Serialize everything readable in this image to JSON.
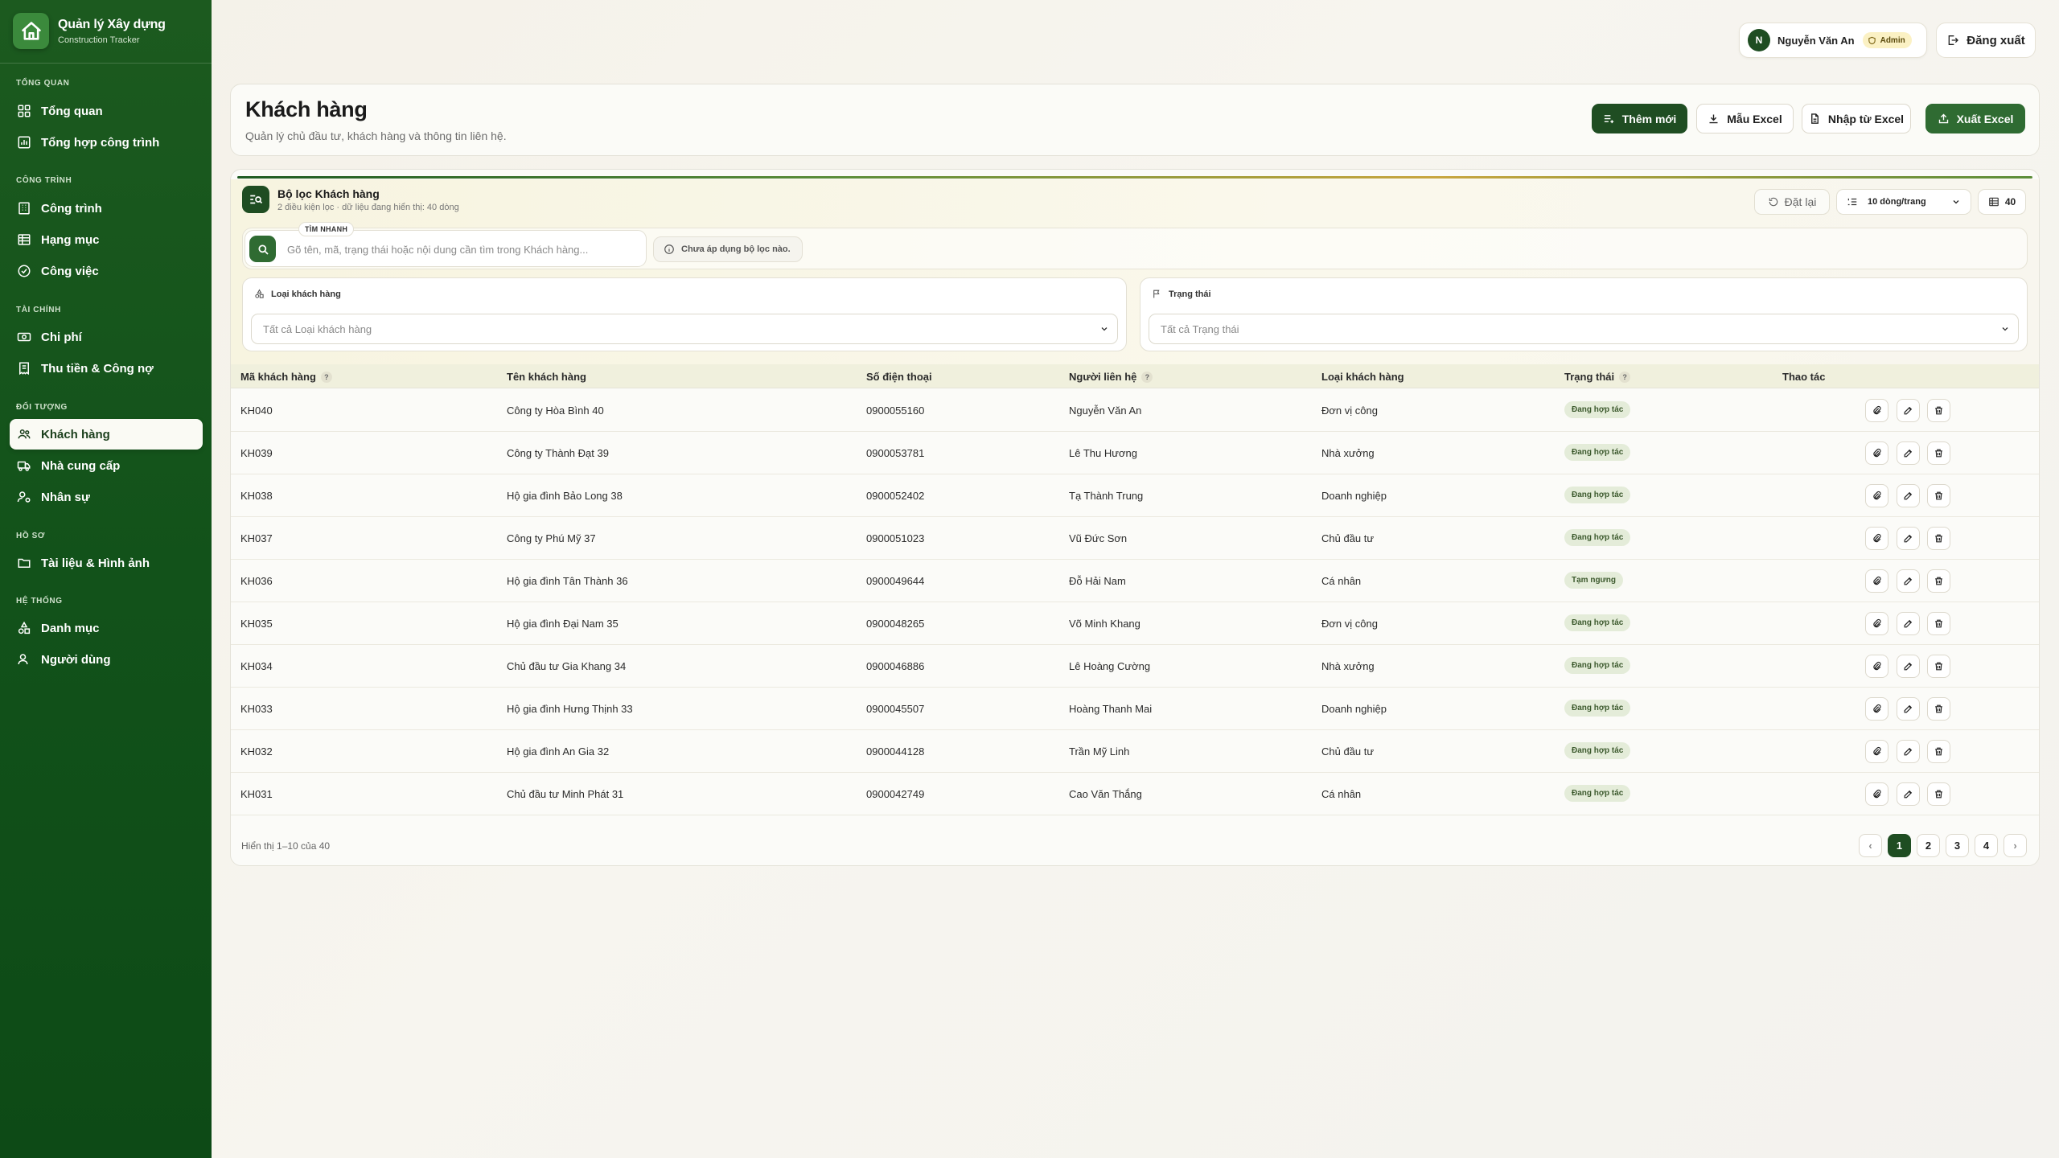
{
  "brand": {
    "title": "Quản lý Xây dựng",
    "subtitle": "Construction Tracker"
  },
  "sidebar": {
    "sections": [
      {
        "label": "TỔNG QUAN",
        "items": [
          {
            "label": "Tổng quan",
            "icon": "dashboard-icon"
          },
          {
            "label": "Tổng hợp công trình",
            "icon": "report-icon"
          }
        ]
      },
      {
        "label": "CÔNG TRÌNH",
        "items": [
          {
            "label": "Công trình",
            "icon": "building-icon"
          },
          {
            "label": "Hạng mục",
            "icon": "table-icon"
          },
          {
            "label": "Công việc",
            "icon": "check-circle-icon"
          }
        ]
      },
      {
        "label": "TÀI CHÍNH",
        "items": [
          {
            "label": "Chi phí",
            "icon": "money-icon"
          },
          {
            "label": "Thu tiền & Công nợ",
            "icon": "receipt-icon"
          }
        ]
      },
      {
        "label": "ĐỐI TƯỢNG",
        "items": [
          {
            "label": "Khách hàng",
            "icon": "users-icon",
            "active": true
          },
          {
            "label": "Nhà cung cấp",
            "icon": "truck-icon"
          },
          {
            "label": "Nhân sự",
            "icon": "user-cog-icon"
          }
        ]
      },
      {
        "label": "HỒ SƠ",
        "items": [
          {
            "label": "Tài liệu & Hình ảnh",
            "icon": "folder-icon"
          }
        ]
      },
      {
        "label": "HỆ THỐNG",
        "items": [
          {
            "label": "Danh mục",
            "icon": "shapes-icon"
          },
          {
            "label": "Người dùng",
            "icon": "user-icon"
          }
        ]
      }
    ]
  },
  "user": {
    "initial": "N",
    "name": "Nguyễn Văn An",
    "role": "Admin",
    "logout": "Đăng xuất"
  },
  "header": {
    "title": "Khách hàng",
    "subtitle": "Quản lý chủ đầu tư, khách hàng và thông tin liên hệ.",
    "buttons": {
      "add": "Thêm mới",
      "template": "Mẫu Excel",
      "import": "Nhập từ Excel",
      "export": "Xuất Excel"
    }
  },
  "filter": {
    "title": "Bộ lọc Khách hàng",
    "subtitle": "2 điều kiện lọc · dữ liệu đang hiển thị: 40 dòng",
    "reset": "Đặt lại",
    "page_size": "10 dòng/trang",
    "total": "40",
    "search_tag": "TÌM NHANH",
    "search_placeholder": "Gõ tên, mã, trạng thái hoặc nội dung cần tìm trong Khách hàng...",
    "no_filter": "Chưa áp dụng bộ lọc nào.",
    "type_label": "Loại khách hàng",
    "type_value": "Tất cả Loại khách hàng",
    "status_label": "Trạng thái",
    "status_value": "Tất cả Trạng thái"
  },
  "table": {
    "columns": [
      "Mã khách hàng",
      "Tên khách hàng",
      "Số điện thoại",
      "Người liên hệ",
      "Loại khách hàng",
      "Trạng thái",
      "Thao tác"
    ],
    "help_mark": "?",
    "rows": [
      {
        "code": "KH040",
        "name": "Công ty Hòa Bình 40",
        "phone": "0900055160",
        "contact": "Nguyễn Văn An",
        "type": "Đơn vị công",
        "status": "Đang hợp tác"
      },
      {
        "code": "KH039",
        "name": "Công ty Thành Đạt 39",
        "phone": "0900053781",
        "contact": "Lê Thu Hương",
        "type": "Nhà xưởng",
        "status": "Đang hợp tác"
      },
      {
        "code": "KH038",
        "name": "Hộ gia đình Bảo Long 38",
        "phone": "0900052402",
        "contact": "Tạ Thành Trung",
        "type": "Doanh nghiệp",
        "status": "Đang hợp tác"
      },
      {
        "code": "KH037",
        "name": "Công ty Phú Mỹ 37",
        "phone": "0900051023",
        "contact": "Vũ Đức Sơn",
        "type": "Chủ đầu tư",
        "status": "Đang hợp tác"
      },
      {
        "code": "KH036",
        "name": "Hộ gia đình Tân Thành 36",
        "phone": "0900049644",
        "contact": "Đỗ Hải Nam",
        "type": "Cá nhân",
        "status": "Tạm ngưng"
      },
      {
        "code": "KH035",
        "name": "Hộ gia đình Đại Nam 35",
        "phone": "0900048265",
        "contact": "Võ Minh Khang",
        "type": "Đơn vị công",
        "status": "Đang hợp tác"
      },
      {
        "code": "KH034",
        "name": "Chủ đầu tư Gia Khang 34",
        "phone": "0900046886",
        "contact": "Lê Hoàng Cường",
        "type": "Nhà xưởng",
        "status": "Đang hợp tác"
      },
      {
        "code": "KH033",
        "name": "Hộ gia đình Hưng Thịnh 33",
        "phone": "0900045507",
        "contact": "Hoàng Thanh Mai",
        "type": "Doanh nghiệp",
        "status": "Đang hợp tác"
      },
      {
        "code": "KH032",
        "name": "Hộ gia đình An Gia 32",
        "phone": "0900044128",
        "contact": "Trần Mỹ Linh",
        "type": "Chủ đầu tư",
        "status": "Đang hợp tác"
      },
      {
        "code": "KH031",
        "name": "Chủ đầu tư Minh Phát 31",
        "phone": "0900042749",
        "contact": "Cao Văn Thắng",
        "type": "Cá nhân",
        "status": "Đang hợp tác"
      }
    ]
  },
  "pagination": {
    "info": "Hiển thị 1–10 của 40",
    "prev": "‹",
    "next": "›",
    "pages": [
      "1",
      "2",
      "3",
      "4"
    ],
    "current": "1"
  },
  "colors": {
    "primary": "#1f4d22",
    "sidebar": "#12521a",
    "accent": "#2f6b32",
    "status_bg": "#e4ecd9",
    "admin_badge": "#fbf1c4"
  }
}
